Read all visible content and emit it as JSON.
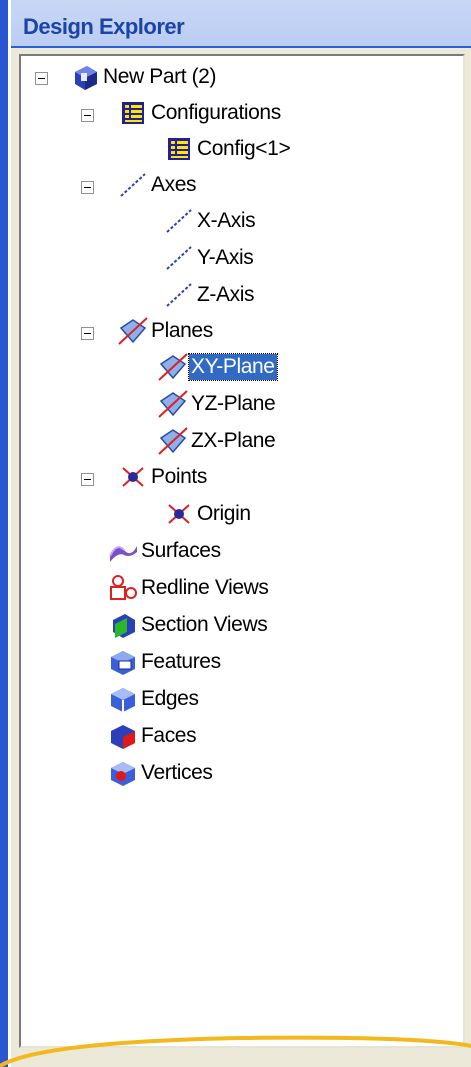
{
  "panel": {
    "title": "Design Explorer"
  },
  "tree": {
    "root": "New Part (2)",
    "configurations": {
      "label": "Configurations",
      "children": [
        "Config<1>"
      ]
    },
    "axes": {
      "label": "Axes",
      "children": [
        "X-Axis",
        "Y-Axis",
        "Z-Axis"
      ]
    },
    "planes": {
      "label": "Planes",
      "children": [
        "XY-Plane",
        "YZ-Plane",
        "ZX-Plane"
      ],
      "selected": "XY-Plane"
    },
    "points": {
      "label": "Points",
      "children": [
        "Origin"
      ]
    },
    "others": [
      "Surfaces",
      "Redline Views",
      "Section Views",
      "Features",
      "Edges",
      "Faces",
      "Vertices"
    ]
  },
  "colors": {
    "selection": "#316ac5",
    "title_text": "#1c43a8",
    "accent_curve": "#f2b81c"
  }
}
